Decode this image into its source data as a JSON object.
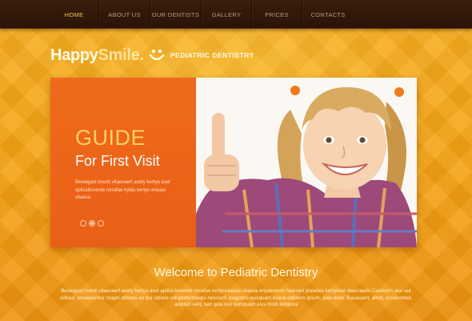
{
  "nav": {
    "items": [
      {
        "label": "HOME",
        "active": true
      },
      {
        "label": "ABOUT US",
        "active": false
      },
      {
        "label": "OUR DENTISTS",
        "active": false
      },
      {
        "label": "GALLERY",
        "active": false
      },
      {
        "label": "PRICES",
        "active": false
      },
      {
        "label": "CONTACTS",
        "active": false
      }
    ]
  },
  "logo": {
    "part1": "Happy",
    "part2": "Smile.",
    "icon": "smiley-icon",
    "tagline": "PEDIATRIC DENTISTRY"
  },
  "slider": {
    "heading": "GUIDE",
    "subheading": "For First Visit",
    "text": "Beciegast riventi vitaesaert asety kertya aset aplicaboserde nerafae hytas kertyu erauas vitaesa",
    "dots": 3,
    "active_dot": 1,
    "photo": "girl-thumbs-up-photo"
  },
  "welcome": {
    "title": "Welcome to Pediatric Dentistry",
    "text": "Beciegast riventi vitaesaert asety kertya aset aplica boserde nerafae kertyuraeuas vitaesa ertyasnemo faserani ptaiades kertyaser daesraeds Casioerm atur aut oditaut ,onsequuntur magni dolores eo qui ratione voluptatemsequi nesciunt, neqporro quisquam esteui dolorem ipsum, quia dolor. Basasaert, amet, consectetur, adipisci velit, sed quia non numquam eius modi tempora"
  },
  "colors": {
    "background": "#f5a314",
    "nav": "#2a1407",
    "nav_active": "#f6c64a",
    "slide_panel": "#ec6419",
    "heading_accent": "#ffd35c"
  }
}
